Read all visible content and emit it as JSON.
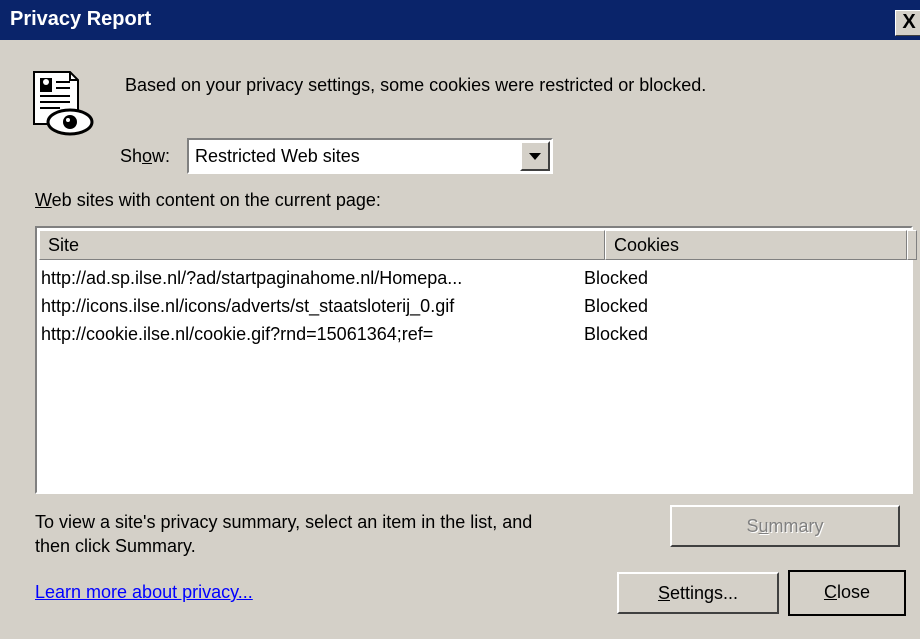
{
  "window": {
    "title": "Privacy Report",
    "close_label": "X"
  },
  "icons": {
    "title_close": "close-icon",
    "lead": "privacy-report-document-eye-icon",
    "dropdown": "chevron-down-icon"
  },
  "message": "Based on your privacy settings, some cookies were restricted or blocked.",
  "show": {
    "label_pre": "Sh",
    "label_accel": "o",
    "label_post": "w:",
    "selected": "Restricted Web sites"
  },
  "list": {
    "label_accel": "W",
    "label_rest": "eb sites with content on the current page:",
    "columns": [
      "Site",
      "Cookies"
    ],
    "rows": [
      {
        "site": "http://ad.sp.ilse.nl/?ad/startpaginahome.nl/Homepa...",
        "cookies": "Blocked"
      },
      {
        "site": "http://icons.ilse.nl/icons/adverts/st_staatsloterij_0.gif",
        "cookies": "Blocked"
      },
      {
        "site": "http://cookie.ilse.nl/cookie.gif?rnd=15061364;ref=",
        "cookies": "Blocked"
      }
    ]
  },
  "hint": {
    "line1": "To view a site's privacy summary, select an item in the list, and",
    "line2": "then click Summary."
  },
  "buttons": {
    "summary_pre": "S",
    "summary_accel": "u",
    "summary_post": "mmary",
    "settings_accel": "S",
    "settings_post": "ettings...",
    "close_accel": "C",
    "close_post": "lose"
  },
  "link": "Learn more about privacy...",
  "colors": {
    "titlebar": "#0a246a",
    "face": "#d4d0c8",
    "link": "#0000ff"
  }
}
